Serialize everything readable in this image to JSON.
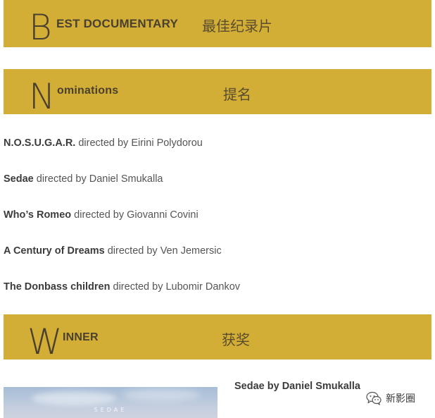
{
  "sections": {
    "best_documentary": {
      "initial": "B",
      "rest": "EST DOCUMENTARY",
      "chinese": "最佳纪录片"
    },
    "nominations": {
      "initial": "N",
      "rest": "ominations",
      "chinese": "提名"
    },
    "winner": {
      "initial": "W",
      "rest": "INNER",
      "chinese": "获奖"
    }
  },
  "nominations": [
    {
      "title": "N.O.S.U.G.A.R.",
      "director": " directed by Eirini Polydorou"
    },
    {
      "title": "Sedae",
      "director": " directed by Daniel Smukalla"
    },
    {
      "title": "Who’s Romeo",
      "director": " directed by Giovanni Covini"
    },
    {
      "title": "A Century of Dreams",
      "director": " directed by Ven Jemersic"
    },
    {
      "title": "The Donbass children",
      "director": " directed by Lubomir Dankov"
    }
  ],
  "winner": {
    "text": "Sedae by Daniel Smukalla",
    "poster_title": "SEDAE"
  },
  "watermark": {
    "icon": "wechat-icon",
    "text": "新影圈"
  },
  "colors": {
    "banner": "#d2ae36",
    "banner_text": "#4a4030"
  }
}
